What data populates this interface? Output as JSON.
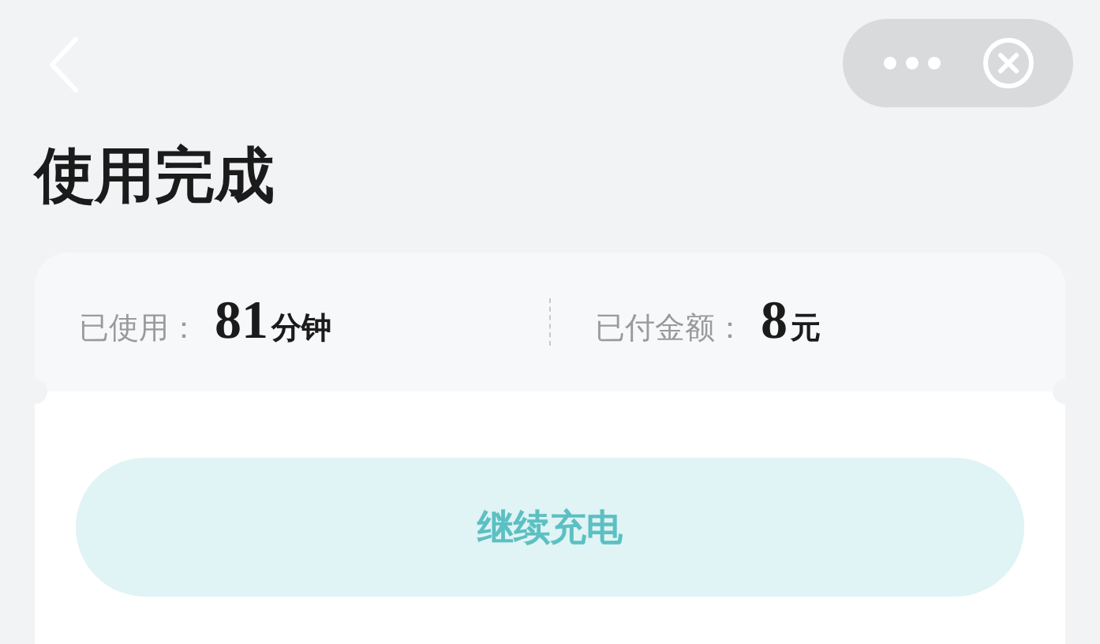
{
  "header": {
    "title": "使用完成"
  },
  "stats": [
    {
      "label": "已使用：",
      "value": "81",
      "unit": "分钟"
    },
    {
      "label": "已付金额：",
      "value": "8",
      "unit": "元"
    }
  ],
  "action": {
    "label": "继续充电"
  }
}
